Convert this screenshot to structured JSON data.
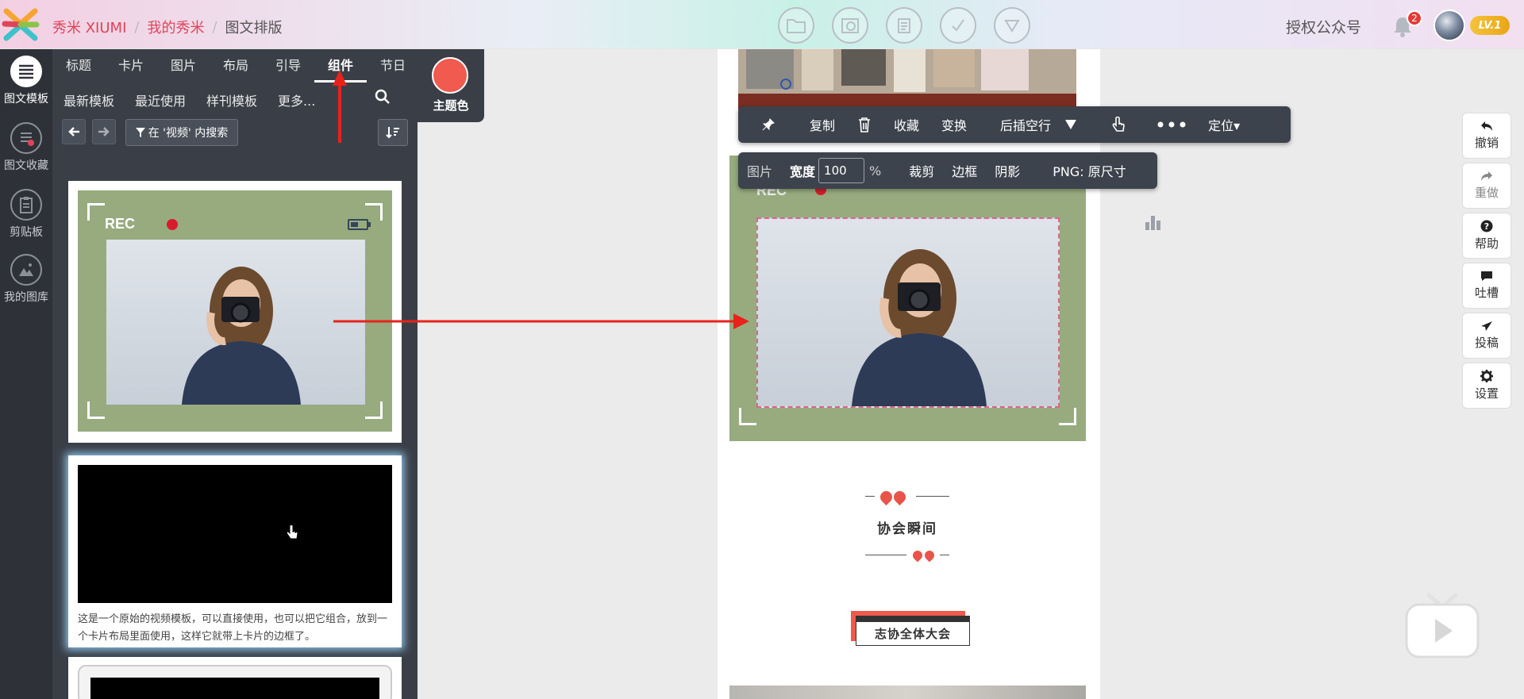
{
  "header": {
    "breadcrumbs": [
      "秀米 XIUMI",
      "我的秀米",
      "图文排版"
    ],
    "separator": "/",
    "toolbar_icons": [
      "folder-icon",
      "camera-icon",
      "copy-icon",
      "check-icon",
      "triangle-down-icon"
    ],
    "auth_label": "授权公众号",
    "notification_count": "2",
    "level_badge": "LV.1"
  },
  "leftbar": {
    "items": [
      {
        "label": "图文模板",
        "icon": "list-icon",
        "active": true
      },
      {
        "label": "图文收藏",
        "icon": "favorites-icon"
      },
      {
        "label": "剪贴板",
        "icon": "clipboard-icon"
      },
      {
        "label": "我的图库",
        "icon": "gallery-icon"
      }
    ]
  },
  "panel": {
    "tabs_row1": [
      "标题",
      "卡片",
      "图片",
      "布局",
      "引导",
      "组件",
      "节日"
    ],
    "active_tab": "组件",
    "tabs_row2": [
      "最新模板",
      "最近使用",
      "样刊模板",
      "更多..."
    ],
    "theme_color_label": "主题色",
    "theme_color": "#f05a4f",
    "filter_label": "在 '视频' 内搜索",
    "template1": {
      "rec_text": "REC"
    },
    "template2": {
      "description": "这是一个原始的视频模板，可以直接使用，也可以把它组合，放到一个卡片布局里面使用，这样它就带上卡片的边框了。"
    }
  },
  "toolbar1": {
    "items": [
      "复制",
      "收藏",
      "变换",
      "后插空行",
      "定位"
    ],
    "positioning_label": "定位▾"
  },
  "toolbar2": {
    "image_label": "图片",
    "width_label": "宽度",
    "width_value": "100",
    "percent": "%",
    "crop_label": "裁剪",
    "border_label": "边框",
    "shadow_label": "阴影",
    "png_label": "PNG: 原尺寸"
  },
  "canvas": {
    "rec_text": "REC",
    "quote_title": "协会瞬间",
    "tag_title": "志协全体大会"
  },
  "right_actions": [
    {
      "label": "撤销",
      "icon": "undo-icon"
    },
    {
      "label": "重做",
      "icon": "redo-icon"
    },
    {
      "label": "帮助",
      "icon": "help-icon"
    },
    {
      "label": "吐槽",
      "icon": "comment-icon"
    },
    {
      "label": "投稿",
      "icon": "send-icon"
    },
    {
      "label": "设置",
      "icon": "gear-icon"
    }
  ],
  "colors": {
    "accent_red": "#e0445a",
    "card_green": "#97ab7f",
    "panel_dark": "#3a3f47",
    "annotation_arrow": "#e8221b"
  }
}
